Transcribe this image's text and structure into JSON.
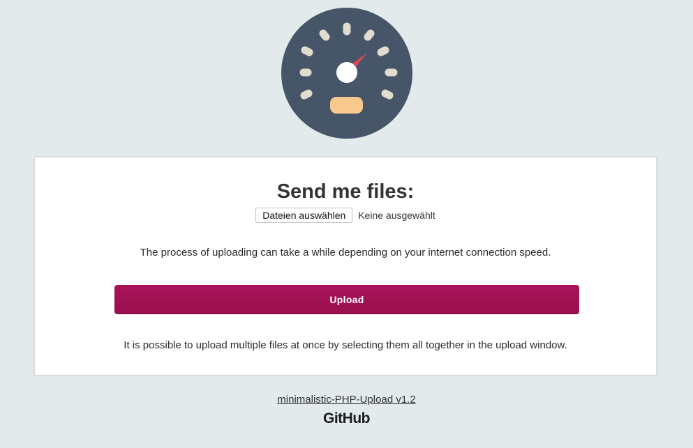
{
  "logo": {
    "icon": "speedometer-icon",
    "colors": {
      "dial": "#475569",
      "ticks": "#e2dccf",
      "needle": "#d84857",
      "hub": "#ffffff",
      "display": "#f7c98c"
    }
  },
  "form": {
    "title": "Send me files:",
    "file_button_label": "Dateien auswählen",
    "file_status": "Keine ausgewählt",
    "speed_notice": "The process of uploading can take a while depending on your internet connection speed.",
    "upload_label": "Upload",
    "multi_hint": "It is possible to upload multiple files at once by selecting them all together in the upload window."
  },
  "footer": {
    "project_link": "minimalistic-PHP-Upload v1.2",
    "github_label": "GitHub"
  },
  "colors": {
    "background": "#e3eaec",
    "card": "#ffffff",
    "accent": "#a11256"
  }
}
